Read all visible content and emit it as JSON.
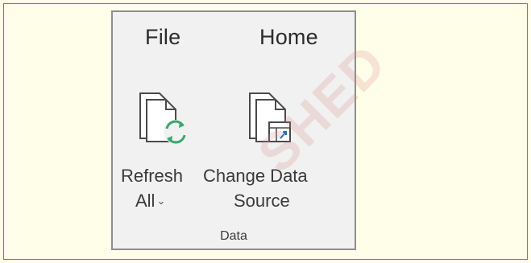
{
  "tabs": {
    "file": "File",
    "home": "Home"
  },
  "commands": {
    "refresh_all": {
      "line1": "Refresh",
      "line2": "All",
      "icon": "refresh-document-icon",
      "dropdown_icon": "chevron-down-icon"
    },
    "change_data_source": {
      "line1": "Change Data",
      "line2": "Source",
      "icon": "change-data-source-icon"
    }
  },
  "group": {
    "label": "Data"
  },
  "watermark": {
    "text": "SHED"
  },
  "colors": {
    "background": "#fffde6",
    "panel": "#f1f1f1",
    "panel_border": "#8e8e8e",
    "refresh_arrows": "#3aa86b",
    "data_icon_accent": "#2b6db6"
  }
}
